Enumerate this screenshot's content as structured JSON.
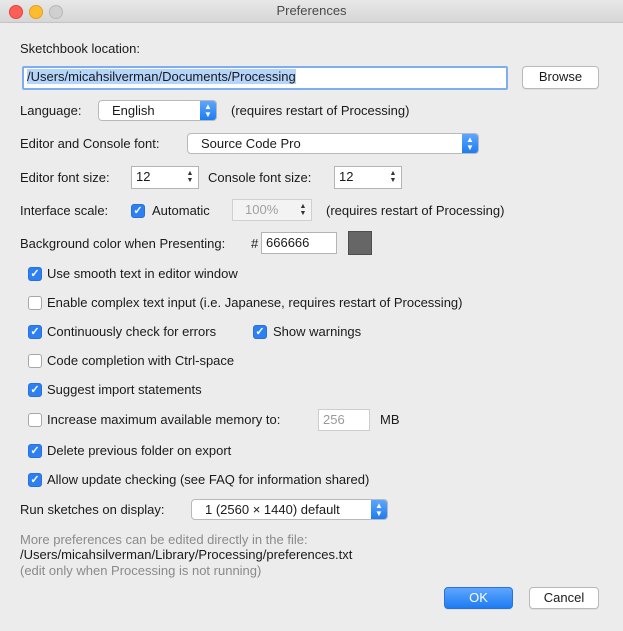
{
  "window": {
    "title": "Preferences"
  },
  "sketchbook": {
    "label": "Sketchbook location:",
    "path": "/Users/micahsilverman/Documents/Processing",
    "browse_label": "Browse"
  },
  "language": {
    "label": "Language:",
    "value": "English",
    "note": "(requires restart of Processing)"
  },
  "font": {
    "label": "Editor and Console font:",
    "value": "Source Code Pro"
  },
  "font_size": {
    "editor_label": "Editor font size:",
    "editor_value": "12",
    "console_label": "Console font size:",
    "console_value": "12"
  },
  "scale": {
    "label": "Interface scale:",
    "automatic_label": "Automatic",
    "automatic_checked": true,
    "value": "100%",
    "note": "(requires restart of Processing)"
  },
  "background": {
    "label": "Background color when Presenting:",
    "hash": "#",
    "value": "666666",
    "color": "#666666"
  },
  "options": {
    "smooth_text": {
      "label": "Use smooth text in editor window",
      "checked": true
    },
    "complex_input": {
      "label": "Enable complex text input (i.e. Japanese, requires restart of Processing)",
      "checked": false
    },
    "check_errors": {
      "label": "Continuously check for errors",
      "checked": true
    },
    "show_warnings": {
      "label": "Show warnings",
      "checked": true
    },
    "code_completion": {
      "label": "Code completion with Ctrl-space",
      "checked": false
    },
    "suggest_imports": {
      "label": "Suggest import statements",
      "checked": true
    },
    "memory": {
      "label": "Increase maximum available memory to:",
      "checked": false,
      "value": "256",
      "unit": "MB"
    },
    "delete_folder": {
      "label": "Delete previous folder on export",
      "checked": true
    },
    "update_check": {
      "label": "Allow update checking (see FAQ for information shared)",
      "checked": true
    }
  },
  "display": {
    "label": "Run sketches on display:",
    "value": "1 (2560 × 1440) default"
  },
  "footer": {
    "line1": "More preferences can be edited directly in the file:",
    "path": "/Users/micahsilverman/Library/Processing/preferences.txt",
    "line3": "(edit only when Processing is not running)"
  },
  "buttons": {
    "ok": "OK",
    "cancel": "Cancel"
  }
}
